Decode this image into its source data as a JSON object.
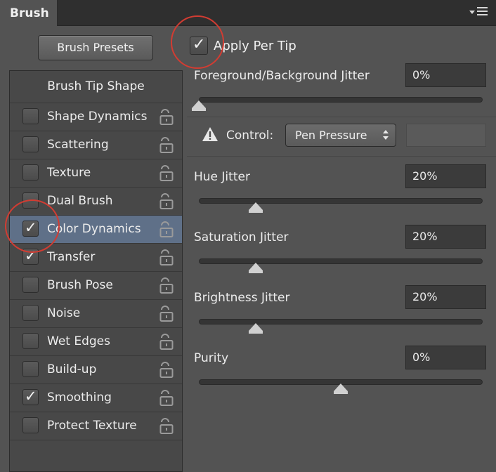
{
  "panel": {
    "tab_title": "Brush",
    "presets_button": "Brush Presets",
    "list_header": "Brush Tip Shape"
  },
  "sidebar": {
    "items": [
      {
        "label": "Shape Dynamics",
        "checked": false
      },
      {
        "label": "Scattering",
        "checked": false
      },
      {
        "label": "Texture",
        "checked": false
      },
      {
        "label": "Dual Brush",
        "checked": false
      },
      {
        "label": "Color Dynamics",
        "checked": true,
        "selected": true
      },
      {
        "label": "Transfer",
        "checked": true
      },
      {
        "label": "Brush Pose",
        "checked": false
      },
      {
        "label": "Noise",
        "checked": false
      },
      {
        "label": "Wet Edges",
        "checked": false
      },
      {
        "label": "Build-up",
        "checked": false
      },
      {
        "label": "Smoothing",
        "checked": true
      },
      {
        "label": "Protect Texture",
        "checked": false
      }
    ]
  },
  "settings": {
    "apply_per_tip": {
      "label": "Apply Per Tip",
      "checked": true
    },
    "fg_bg_jitter": {
      "label": "Foreground/Background Jitter",
      "value": "0%",
      "level": 0
    },
    "control": {
      "label": "Control:",
      "selected": "Pen Pressure"
    },
    "hue_jitter": {
      "label": "Hue Jitter",
      "value": "20%",
      "level": 0.2
    },
    "saturation_jitter": {
      "label": "Saturation Jitter",
      "value": "20%",
      "level": 0.2
    },
    "brightness_jitter": {
      "label": "Brightness Jitter",
      "value": "20%",
      "level": 0.2
    },
    "purity": {
      "label": "Purity",
      "value": "0%",
      "level": 0.5
    }
  },
  "colors": {
    "panel_bg": "#535353",
    "selected_row": "#5f7088",
    "annotation_circle": "#d23c32"
  },
  "icons": {
    "lock": "lock-icon",
    "warning": "warning-icon",
    "menu": "panel-menu-icon",
    "check": "checkmark-icon"
  }
}
